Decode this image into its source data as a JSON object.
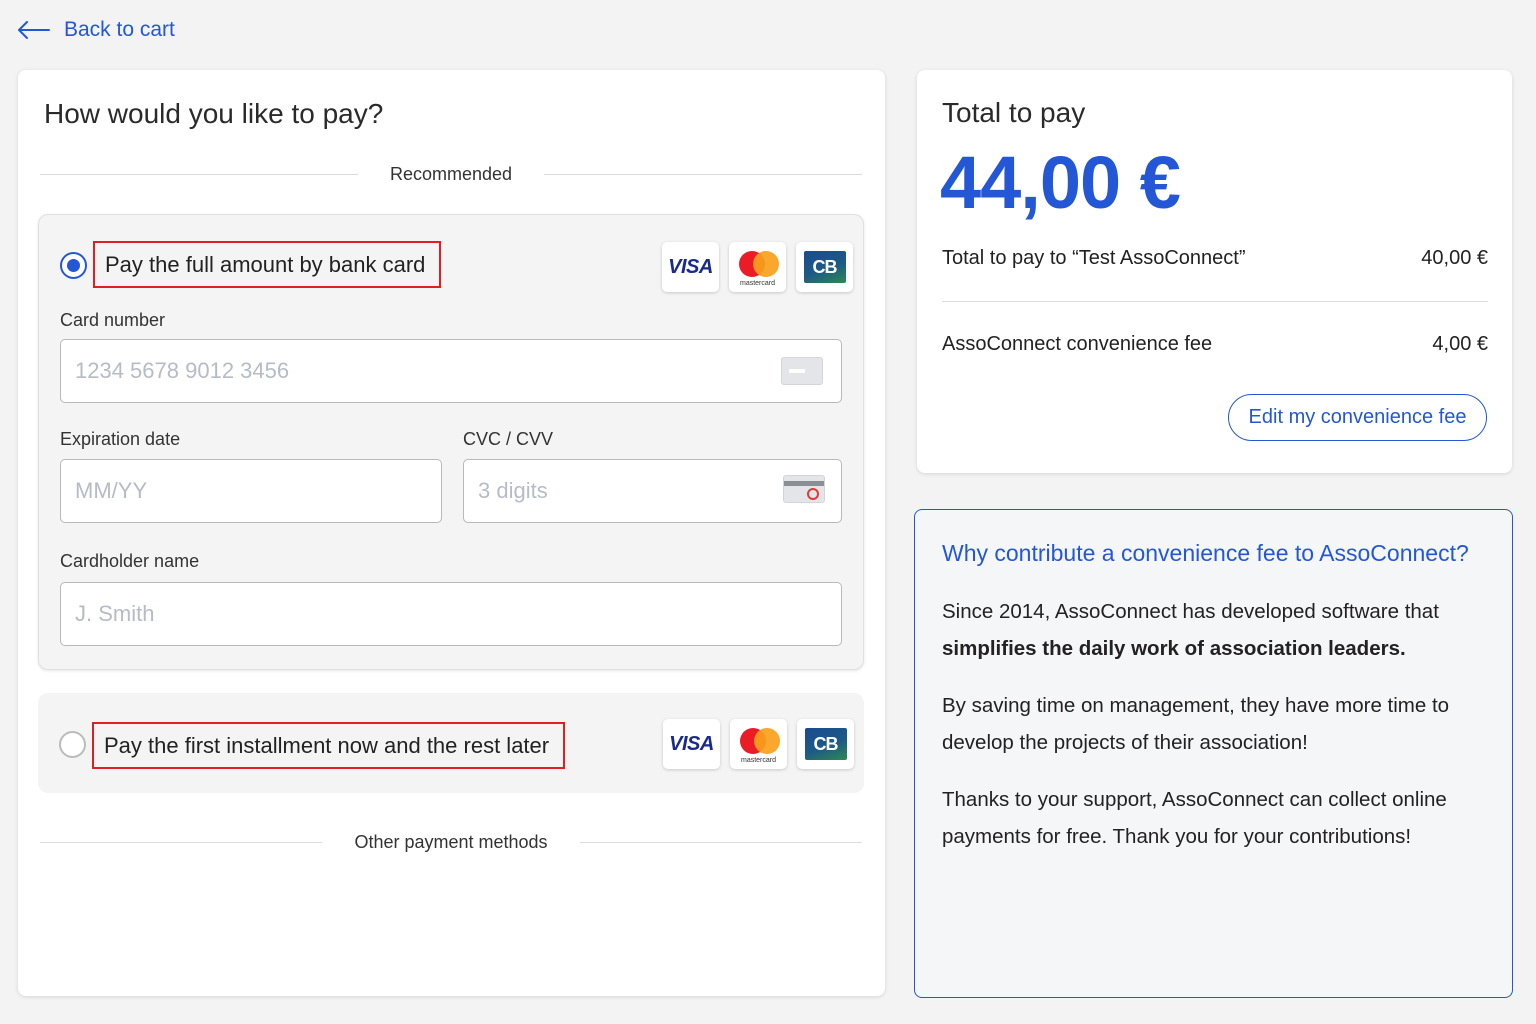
{
  "nav": {
    "back_label": "Back to cart"
  },
  "payment": {
    "title": "How would you like to pay?",
    "recommended_label": "Recommended",
    "options": [
      {
        "label": "Pay the full amount by bank card",
        "selected": true
      },
      {
        "label": "Pay the first installment now and the rest later",
        "selected": false
      }
    ],
    "brands": {
      "visa": "VISA",
      "mastercard": "mastercard",
      "cb": "CB"
    },
    "fields": {
      "card_number": {
        "label": "Card number",
        "placeholder": "1234 5678 9012 3456"
      },
      "expiration": {
        "label": "Expiration date",
        "placeholder": "MM/YY"
      },
      "cvc": {
        "label": "CVC / CVV",
        "placeholder": "3 digits"
      },
      "cardholder": {
        "label": "Cardholder name",
        "placeholder": "J. Smith"
      }
    },
    "other_methods_label": "Other payment methods"
  },
  "summary": {
    "title": "Total to pay",
    "total": "44,00 €",
    "rows": [
      {
        "label": "Total to pay to “Test AssoConnect”",
        "value": "40,00 €"
      },
      {
        "label": "AssoConnect convenience fee",
        "value": "4,00 €"
      }
    ],
    "edit_button": "Edit my convenience fee"
  },
  "why": {
    "title": "Why contribute a convenience fee to AssoConnect?",
    "p1_text": "Since 2014, AssoConnect has developed software that ",
    "p1_bold": "simplifies the daily work of association leaders.",
    "p2": "By saving time on management, they have more time to develop the projects of their association!",
    "p3": "Thanks to your support, AssoConnect can collect online payments for free. Thank you for your contributions!"
  },
  "colors": {
    "accent": "#2457d6",
    "highlight_border": "#e02020"
  }
}
